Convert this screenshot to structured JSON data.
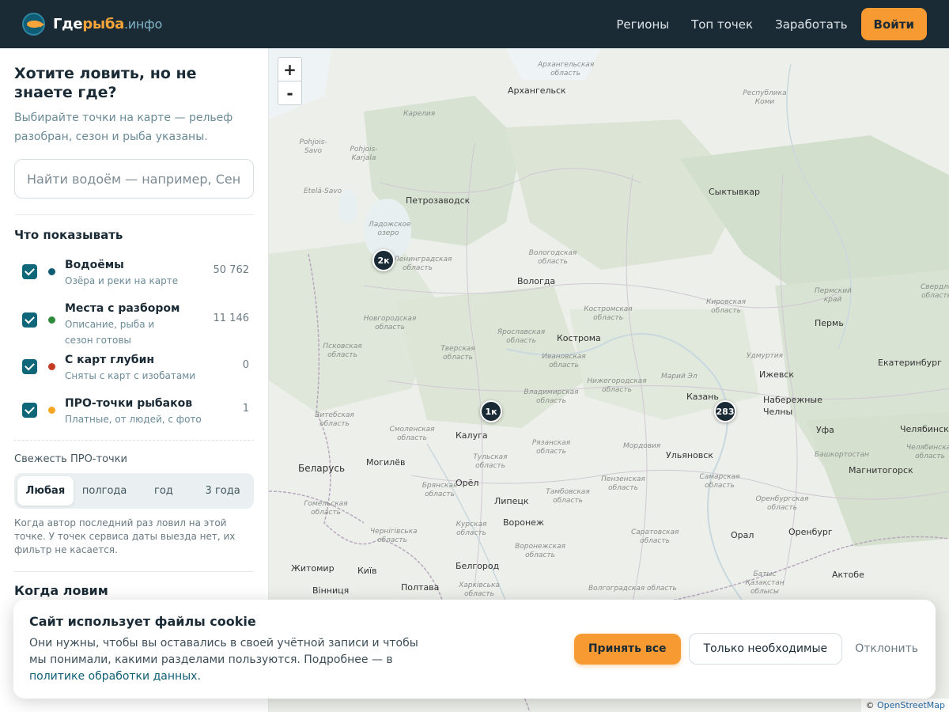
{
  "header": {
    "logo": {
      "part1": "Где",
      "part2": "рыба",
      "part3": ".инфо"
    },
    "nav": [
      "Регионы",
      "Топ точек",
      "Заработать"
    ],
    "login": "Войти"
  },
  "sidebar": {
    "title": "Хотите ловить, но не знаете где?",
    "subtitle": "Выбирайте точки на карте — рельеф разобран, сезон и рыба указаны.",
    "search_placeholder": "Найти водоём — например, Сен",
    "show_heading": "Что показывать",
    "layers": [
      {
        "name": "Водоёмы",
        "desc": "Озёра и реки на карте",
        "count": "50 762",
        "color": "#0f5d74"
      },
      {
        "name": "Места с разбором",
        "desc": "Описание, рыба и сезон готовы",
        "count": "11 146",
        "color": "#2e8b3a"
      },
      {
        "name": "С карт глубин",
        "desc": "Сняты с карт с изобатами",
        "count": "0",
        "color": "#c23b22"
      },
      {
        "name": "ПРО-точки рыбаков",
        "desc": "Платные, от людей, с фото",
        "count": "1",
        "color": "#f5a623"
      }
    ],
    "freshness_heading": "Свежесть ПРО-точки",
    "freshness_options": [
      "Любая",
      "полгода",
      "год",
      "3 года"
    ],
    "freshness_note": "Когда автор последний раз ловил на этой точке. У точек сервиса даты выезда нет, их фильтр не касается.",
    "when_heading": "Когда ловим"
  },
  "map": {
    "zoom_in": "+",
    "zoom_out": "-",
    "attribution_symbol": "©",
    "attribution": "OpenStreetMap",
    "cities": [
      "Архангельск",
      "Петрозаводск",
      "Сыктывкар",
      "Вологда",
      "Кострома",
      "Пермь",
      "Ижевск",
      "Екатеринбург",
      "Набережные Челны",
      "Казань",
      "Калуга",
      "Ульяновск",
      "Уфа",
      "Челябинск",
      "Магнитогорск",
      "Орёл",
      "Липецк",
      "Воронеж",
      "Оренбург",
      "Орал",
      "Белгород",
      "Полтава",
      "Житомир",
      "Київ",
      "Вінниця",
      "Могилёв",
      "Беларусь",
      "Актобе"
    ],
    "regions": [
      "Архангельская область",
      "Республика Коми",
      "Карелия",
      "Pohjois-Savo",
      "Pohjois-Karjala",
      "Etelä-Savo",
      "Ладожское озеро",
      "Ленинградская область",
      "Вологодская область",
      "Новгородская область",
      "Костромская область",
      "Кировская область",
      "Пермский край",
      "Свердловская область",
      "Псковская область",
      "Тверская область",
      "Ярославская область",
      "Ивановская область",
      "Удмуртия",
      "Нижегородская область",
      "Марий Эл",
      "Владимирская область",
      "Смоленская область",
      "Рязанская область",
      "Мордовия",
      "Башкортостан",
      "Челябинская область",
      "Самарская область",
      "Витебская область",
      "Тульская область",
      "Брянская область",
      "Тамбовская область",
      "Пензенская область",
      "Оренбургская область",
      "Гомельская область",
      "Курская область",
      "Саратовская область",
      "Чернігівська область",
      "Воронежская область",
      "Батыс Қазақстан облысы",
      "Харківська область",
      "Волгоградская область"
    ],
    "clusters": [
      "2к",
      "1к",
      "283"
    ]
  },
  "cookie": {
    "title": "Сайт использует файлы cookie",
    "text": "Они нужны, чтобы вы оставались в своей учётной записи и чтобы мы понимали, какими разделами пользуются. Подробнее — в",
    "link": "политике обработки данных.",
    "accept": "Принять все",
    "necessary": "Только необходимые",
    "decline": "Отклонить"
  }
}
